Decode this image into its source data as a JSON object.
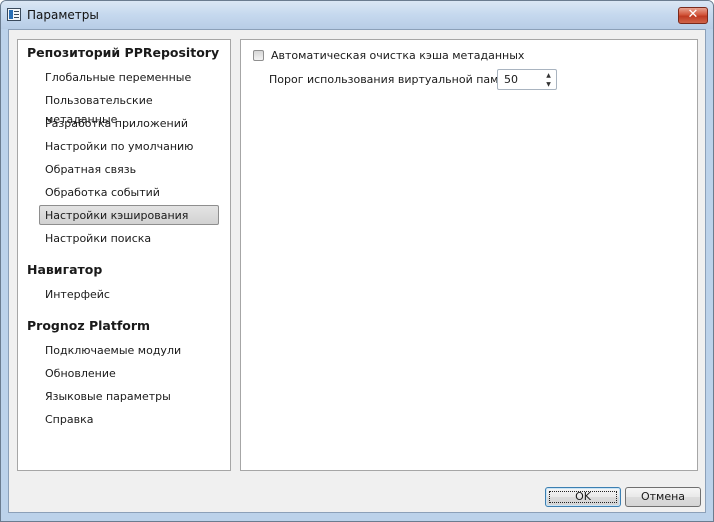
{
  "window": {
    "title": "Параметры",
    "close_glyph": "✕"
  },
  "nav": {
    "groups": [
      {
        "title": "Репозиторий PPRepository",
        "items": [
          {
            "label": "Глобальные переменные",
            "selected": false
          },
          {
            "label": "Пользовательские метаданные",
            "selected": false
          },
          {
            "label": "Разработка приложений",
            "selected": false
          },
          {
            "label": "Настройки по умолчанию",
            "selected": false
          },
          {
            "label": "Обратная связь",
            "selected": false
          },
          {
            "label": "Обработка событий",
            "selected": false
          },
          {
            "label": "Настройки кэширования",
            "selected": true
          },
          {
            "label": "Настройки поиска",
            "selected": false
          }
        ]
      },
      {
        "title": "Навигатор",
        "items": [
          {
            "label": "Интерфейс",
            "selected": false
          }
        ]
      },
      {
        "title": "Prognoz Platform",
        "items": [
          {
            "label": "Подключаемые модули",
            "selected": false
          },
          {
            "label": "Обновление",
            "selected": false
          },
          {
            "label": "Языковые параметры",
            "selected": false
          },
          {
            "label": "Справка",
            "selected": false
          }
        ]
      }
    ]
  },
  "content": {
    "auto_clear_checkbox": {
      "label": "Автоматическая очистка кэша метаданных",
      "checked": false
    },
    "vm_threshold": {
      "label": "Порог использования виртуальной памяти:",
      "value": "50",
      "up_glyph": "▲",
      "down_glyph": "▼"
    }
  },
  "buttons": {
    "ok": "OK",
    "cancel": "Отмена"
  },
  "colors": {
    "title_bar": "#c5d8ee",
    "close_button": "#d2553b",
    "dialog_bg": "#f0f0f0",
    "selected_item": "#d9d9d9"
  }
}
